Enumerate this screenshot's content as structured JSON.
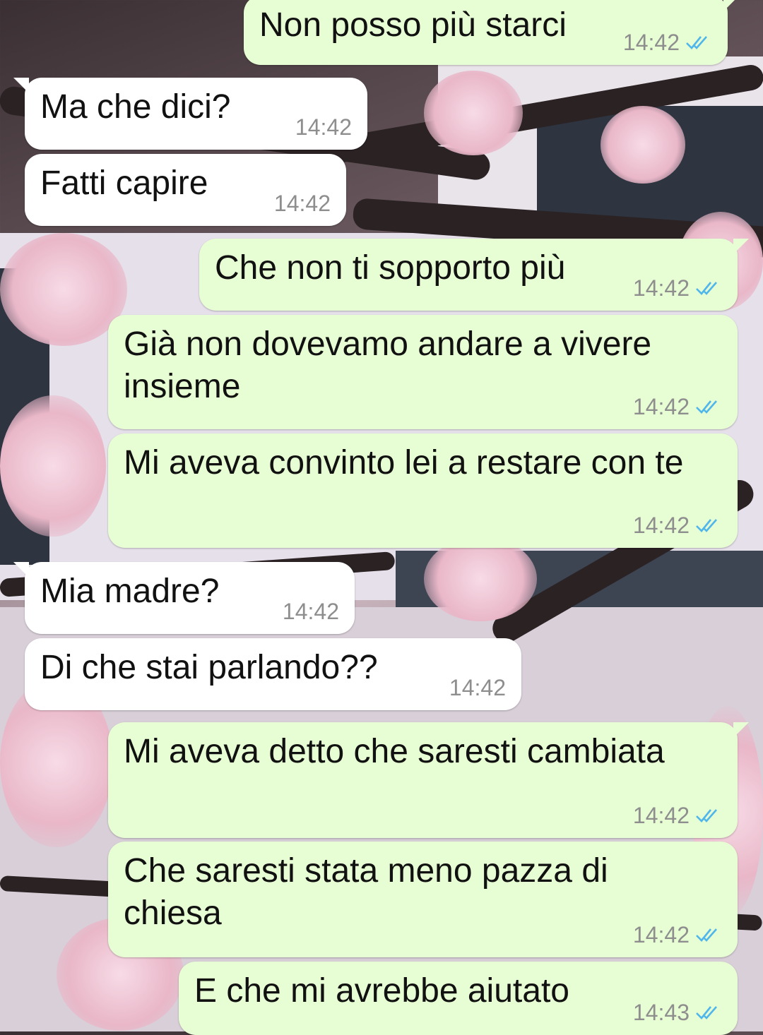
{
  "messages": [
    {
      "dir": "out",
      "text": "Non posso più starci",
      "time": "14:42",
      "read": true
    },
    {
      "dir": "in",
      "text": "Ma che dici?",
      "time": "14:42"
    },
    {
      "dir": "in",
      "text": "Fatti capire",
      "time": "14:42"
    },
    {
      "dir": "out",
      "text": "Che non ti sopporto più",
      "time": "14:42",
      "read": true
    },
    {
      "dir": "out",
      "text": "Già non dovevamo andare a vivere insieme",
      "time": "14:42",
      "read": true
    },
    {
      "dir": "out",
      "text": "Mi aveva convinto lei a restare con te",
      "time": "14:42",
      "read": true
    },
    {
      "dir": "in",
      "text": "Mia madre?",
      "time": "14:42"
    },
    {
      "dir": "in",
      "text": "Di che stai parlando??",
      "time": "14:42"
    },
    {
      "dir": "out",
      "text": "Mi aveva detto che saresti cambiata",
      "time": "14:42",
      "read": true
    },
    {
      "dir": "out",
      "text": "Che saresti stata meno pazza di chiesa",
      "time": "14:42",
      "read": true
    },
    {
      "dir": "out",
      "text": "E che mi avrebbe aiutato",
      "time": "14:43",
      "read": true
    }
  ],
  "colors": {
    "outgoing_bubble": "#e7fdd3",
    "incoming_bubble": "#ffffff",
    "read_tick": "#4fb6ec",
    "timestamp": "#8e8e8e"
  },
  "icons": {
    "read_receipt": "double-check-icon"
  }
}
